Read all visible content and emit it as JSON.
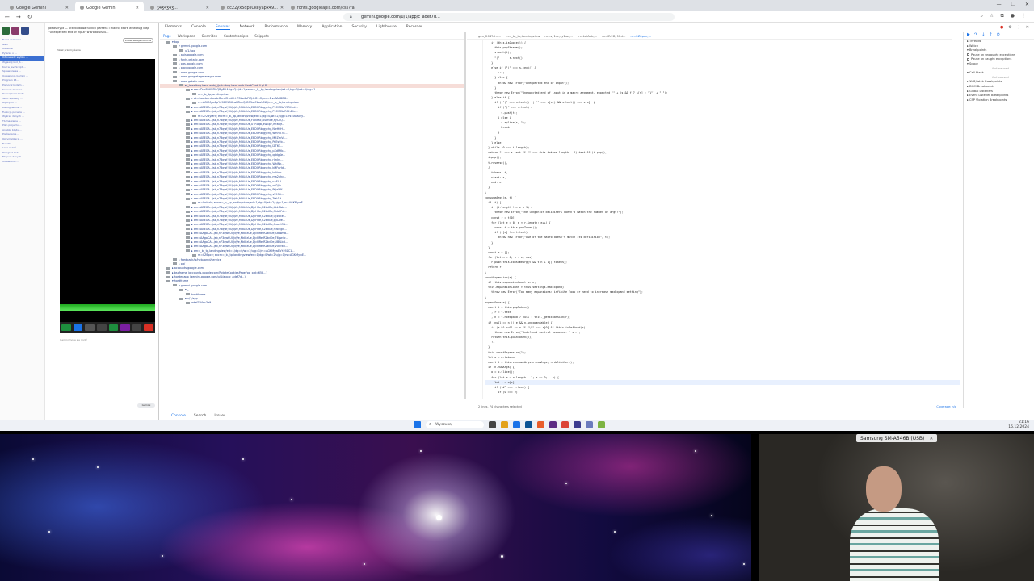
{
  "browser": {
    "tabs": [
      {
        "label": "Google Gemini",
        "active": false
      },
      {
        "label": "Google Gemini",
        "active": true
      },
      {
        "label": "ʒ4ʒ4ʒ4ʒ...",
        "active": false
      },
      {
        "label": "dc22yx5dpsCkeyapx49...",
        "active": false
      },
      {
        "label": "fonts.googleapis.com/css?family...",
        "active": false
      }
    ],
    "url": "gemini.google.com/u/1/app/c_adef7d...",
    "window_controls": [
      "—",
      "❐",
      "✕"
    ]
  },
  "page": {
    "sidebar_items": [
      "Nowa rozmowa",
      "Gem",
      "Ostatnie",
      "Pytanie o ...",
      "Odpowiedz szybko ...",
      "Wyjaśnij kod JS ...",
      "Kod w JavaScript ...",
      "Sprawdzenie ...",
      "Ustawienia Gemini ...",
      "Program 16 ...",
      "Pomoc z kodem ...",
      "Konsola Chrome ...",
      "Rozwiązanie testu ...",
      "Szkic aplikacji ...",
      "Algorytm ...",
      "Debugowanie ...",
      "Funkcja parsera ...",
      "Wykres danych ...",
      "Tłumaczenie ...",
      "Plan projektu ...",
      "Analiza błędu ...",
      "Porównanie ...",
      "Optymalizacja ...",
      "Notatki ...",
      "Lista zadań ...",
      "Przegląd kodu ...",
      "Eksport danych ...",
      "Ustawienia ..."
    ],
    "selected_item_index": 4,
    "title": "Jawaskrypt — przebudowa funkcji parsera i macro, które wywołują błąd \"Unexpected end of input\" w środowisku...",
    "action_button": "Pokaż wersje robocze",
    "subtitle": "Pokaż przemyślenia",
    "footer": "Gemini może się mylić",
    "pill": "Gemini"
  },
  "devtools": {
    "top_tabs": [
      "Elements",
      "Console",
      "Sources",
      "Network",
      "Performance",
      "Memory",
      "Application",
      "Security",
      "Lighthouse",
      "Recorder"
    ],
    "active_top_tab": "Sources",
    "nav_tabs": [
      "Page",
      "Workspace",
      "Overrides",
      "Content scripts",
      "Snippets"
    ],
    "active_nav_tab": "Page",
    "tree": [
      {
        "indent": 0,
        "text": "▾ top"
      },
      {
        "indent": 1,
        "text": "▾ gemini.google.com"
      },
      {
        "indent": 2,
        "text": "u/1/app"
      },
      {
        "indent": 1,
        "text": "▸ apis.google.com"
      },
      {
        "indent": 1,
        "text": "▸ fonts.gstatic.com"
      },
      {
        "indent": 1,
        "text": "▸ ogs.google.com"
      },
      {
        "indent": 1,
        "text": "▸ play.google.com"
      },
      {
        "indent": 1,
        "text": "▸ www.google.com"
      },
      {
        "indent": 1,
        "text": "▸ www.googletagmanager.com"
      },
      {
        "indent": 1,
        "text": "▸ www.gstatic.com"
      },
      {
        "indent": 2,
        "text": "▾ _/mss/boq-bard-web/_/js/k=boq-bard-web.BardChatUi.pl.8..."
      },
      {
        "indent": 3,
        "text": "▾ am=DvcBAKBD8QBgBAAAgAQ=/d=1/excm=_b,_tp,landingview/ed=1/dg=0/wt=2/ujg=1"
      },
      {
        "indent": 4,
        "text": "m=_b,_tp,landingview"
      },
      {
        "indent": 3,
        "text": "▾ ck=boq-bard-web.BardChatUi.hFSbo4bFtQ.L.B1.O/am=DvcBAKBD8..."
      },
      {
        "indent": 4,
        "text": "rs=AGKMywEpYx9ZC1DKtwHRxeQ8MWuM1xoUMA/m=_b,_tp,landingview"
      },
      {
        "indent": 3,
        "text": "▸ am=ABEGA...jsb,n73qwf,UUJqVe,MdUzUe,EEDORb,gychg,P9M9Cb,Y5RHcd..."
      },
      {
        "indent": 3,
        "text": "▸ am=ABEGA...jsb,n73qwf,UUJqVe,MdUzUe,EEDORb,gychg,P9M9Cb,RMhBfe..."
      },
      {
        "indent": 4,
        "text": "m=Zr2ByMrd; excm=_b,_tp,landingview/ed=1/dg=0/wt=2/ujg=1/rs=AGKMy..."
      },
      {
        "indent": 3,
        "text": "▸ am=ABEGA...jsb,n73qwf,UUJqVe,MdUzUe,FGk8ac,DSPnbe,RyCcQ..."
      },
      {
        "indent": 3,
        "text": "▸ am=ABEGA...jsb,n73qwf,UUJqVe,MdUzUe,UTPZqb,aW3pY,Wt6vjf..."
      },
      {
        "indent": 3,
        "text": "▸ am=ABEGA...jsb,n73qwf,UUJqVe,MdUzUe,EEDORb,gychg,NwH0H..."
      },
      {
        "indent": 3,
        "text": "▸ am=ABEGA...jsb,n73qwf,UUJqVe,MdUzUe,EEDORb,gychg,wmnU7d..."
      },
      {
        "indent": 3,
        "text": "▸ am=ABEGA...jsb,n73qwf,UUJqVe,MdUzUe,EEDORb,gychg,M9ZmVc..."
      },
      {
        "indent": 3,
        "text": "▸ am=ABEGA...jsb,n73qwf,UUJqVe,MdUzUe,EEDORb,gychg,PoEs9b..."
      },
      {
        "indent": 3,
        "text": "▸ am=ABEGA...jsb,n73qwf,UUJqVe,MdUzUe,EEDORb,gychg,IZT63..."
      },
      {
        "indent": 3,
        "text": "▸ am=ABEGA...jsb,n73qwf,UUJqVe,MdUzUe,EEDORb,gychg,pXdRYb..."
      },
      {
        "indent": 3,
        "text": "▸ am=ABEGA...jsb,n73qwf,UUJqVe,MdUzUe,EEDORb,gychg,qddgKe..."
      },
      {
        "indent": 3,
        "text": "▸ am=ABEGA...jsb,n73qwf,UUJqVe,MdUzUe,EEDORb,gychg,rJmJrc..."
      },
      {
        "indent": 3,
        "text": "▸ am=ABEGA...jsb,n73qwf,UUJqVe,MdUzUe,EEDORb,gychg,WhJNk..."
      },
      {
        "indent": 3,
        "text": "▸ am=ABEGA...jsb,n73qwf,UUJqVe,MdUzUe,EEDORb,gychg,kMFpHd..."
      },
      {
        "indent": 3,
        "text": "▸ am=ABEGA...jsb,n73qwf,UUJqVe,MdUzUe,EEDORb,gychg,lsjVmc..."
      },
      {
        "indent": 3,
        "text": "▸ am=ABEGA...jsb,n73qwf,UUJqVe,MdUzUe,EEDORb,gychg,ma2uhc..."
      },
      {
        "indent": 3,
        "text": "▸ am=ABEGA...jsb,n73qwf,UUJqVe,MdUzUe,EEDORb,gychg,nAFL3..."
      },
      {
        "indent": 3,
        "text": "▸ am=ABEGA...jsb,n73qwf,UUJqVe,MdUzUe,EEDORb,gychg,o02Jie..."
      },
      {
        "indent": 3,
        "text": "▸ am=ABEGA...jsb,n73qwf,UUJqVe,MdUzUe,EEDORb,gychg,PQaYAf..."
      },
      {
        "indent": 3,
        "text": "▸ am=ABEGA...jsb,n73qwf,UUJqVe,MdUzUe,EEDORb,gychg,s39S4..."
      },
      {
        "indent": 3,
        "text": "▸ am=ABEGA...jsb,n73qwf,UUJqVe,MdUzUe,EEDORb,gychg,TrYr1d..."
      },
      {
        "indent": 4,
        "text": "m=LoiAxb; excm=_b,_tp,landingview/ed=1/dg=0/wt=2/ujg=1/rs=AGKMywE..."
      },
      {
        "indent": 3,
        "text": "▸ am=ABEGA...jsb,n73qwf,UUJqVe,MdUzUe,DjcHRe,R2kdOe,KkLMsb..."
      },
      {
        "indent": 3,
        "text": "▸ am=ABEGA...jsb,n73qwf,UUJqVe,MdUzUe,DjcHRe,R2kdOe,NkbkFd..."
      },
      {
        "indent": 3,
        "text": "▸ am=ABEGA...jsb,n73qwf,UUJqVe,MdUzUe,DjcHRe,R2kdOe,Oj465e..."
      },
      {
        "indent": 3,
        "text": "▸ am=ABEGA...jsb,n73qwf,UUJqVe,MdUzUe,DjcHRe,R2kdOe,pjICDe..."
      },
      {
        "indent": 3,
        "text": "▸ am=ABEGA...jsb,n73qwf,UUJqVe,MdUzUe,DjcHRe,R2kdOe,QwzHOd..."
      },
      {
        "indent": 3,
        "text": "▸ am=ABEGA...jsb,n73qwf,UUJqVe,MdUzUe,DjcHRe,R2kdOe,rE6Mgd..."
      },
      {
        "indent": 3,
        "text": "▸ am=AAgoCA...jsb,n73qwf,UUJqVe,MdUzUe,DjcHRe,R2kdOe,SdcwHb..."
      },
      {
        "indent": 3,
        "text": "▸ am=AAgoCA...jsb,n73qwf,UUJqVe,MdUzUe,DjcHRe,R2kdOe,T6gw4c..."
      },
      {
        "indent": 3,
        "text": "▸ am=AAgoCA...jsb,n73qwf,UUJqVe,MdUzUe,DjcHRe,R2kdOe,UBtLbd..."
      },
      {
        "indent": 3,
        "text": "▸ am=AAgoCA...jsb,n73qwf,UUJqVe,MdUzUe,DjcHRe,R2kdOe,VXdfxd..."
      },
      {
        "indent": 3,
        "text": "▸ am=_b,_tp,landingview/ed=1/dg=0/wt=2/ujg=1/rs=AGKMywEpYx9ZC1..."
      },
      {
        "indent": 4,
        "text": "m=kZ6pce; excm=_b,_tp,landingview/ed=1/dg=0/wt=2/ujg=1/rs=AGKMywE..."
      },
      {
        "indent": 1,
        "text": "▸ feedback/js/help/prod/service"
      },
      {
        "indent": 1,
        "text": "▸ og/_"
      },
      {
        "indent": 0,
        "text": "▸ accounts.google.com"
      },
      {
        "indent": 0,
        "text": "▸ bscframe (accounts.google.com/RotateCookiesPage?og_pid=658...)"
      },
      {
        "indent": 0,
        "text": "▸ hostedapp (gemini.google.com/u/1/app/c_adef7d...)"
      },
      {
        "indent": 0,
        "text": "▾ hostframe"
      },
      {
        "indent": 1,
        "text": "▾ gemini.google.com"
      },
      {
        "indent": 2,
        "text": "▾ _"
      },
      {
        "indent": 3,
        "text": "hostframe"
      },
      {
        "indent": 2,
        "text": "▾ u/1/app"
      },
      {
        "indent": 3,
        "text": "adef7d4ec3a9"
      }
    ],
    "tree_highlight_indices": [
      10
    ],
    "tree_selected_indices": [],
    "editor_tabs": [
      "gen_204?zl=...",
      "m=_b,_tp,landingview",
      "m=sy1sc,sy1se,...",
      "m=LoiAxb,...",
      "m=Zr2ByMrd...",
      "m=kZ6pce,..."
    ],
    "active_editor_tab_index": 5,
    "code_lines": [
      "    if (this.isQuote()) {",
      "      this.popStream();",
      "      s.push(t);",
      "      \"(\"      s.next()",
      "    }",
      "    else if (\"(\" === s.text() {",
      "        ++i;",
      "      } else {",
      "        throw new Error(\"Unexpected end of input\");",
      "      }",
      "      throw new Error(\"Unexpected end of input in a macro argument, expected '\" + (s && f ? s[s] : \"}\") + \"'\");",
      "    } else if {",
      "      if ((\"(\" === s.text() || \"\" === s[s]) && s.text() === s[s]) {",
      "        if (\"(\" === s.text) {",
      "          s.push(t);",
      "        } else {",
      "          s.splice(s, 1);",
      "          break",
      "        }",
      "      }",
      "    } else",
      "  } while (0 === i.length);",
      "  return \"\" === s.text && \"\" === this.tokens.length - 1).text && (i.pop(),",
      "  i.pop(),",
      "  t.reverse(),",
      "  {",
      "    tokens: t,",
      "    start: s,",
      "    end: e",
      "  }",
      "}",
      "consumeArgs(e, t) {",
      "  if (t) {",
      "    if (t.length !== e + 1) {",
      "      throw new Error(\"The length of delimiters doesn't match the number of args!\");",
      "    const r = t[0];",
      "    for (let e = 0; e < r.length; e++) {",
      "      const t = this.popToken();",
      "      if (r[e] !== t.text)",
      "        throw new Error(\"Use of the macro doesn't match its definition\", t);",
      "    }",
      "  }",
      "  const r = [];",
      "  for (let n = 0; n < e; n++)",
      "    r.push(this.consumeArg(t && t[n + 1]).tokens);",
      "  return r",
      "}",
      "countExpansion(e) {",
      "  if (this.expansionCount += e,",
      "  this.expansionCount > this.settings.maxExpand)",
      "    throw new Error(\"Too many expansions: infinite loop or need to increase maxExpand setting\");",
      "}",
      "expandOnce(e) {",
      "  const t = this.popToken()",
      "    , r = t.text",
      "    , n = t.noexpand ? null : this._getExpansion(r);",
      "  if (null == n || e && n.unexpandable) {",
      "    if (e && null == n && \"\\\\\" === r[0] && !this.isDefined(r))",
      "      throw new Error(\"Undefined control sequence: \" + r);",
      "    return this.pushToken(t),",
      "    !1",
      "  }",
      "  this.countExpansion(1);",
      "  let o = n.tokens;",
      "  const l = this.consumeArgs(n.numArgs, n.delimiters);",
      "  if (n.numArgs) {",
      "    o = o.slice();",
      "    for (let e = o.length - 1; e >= 0; --e) {",
      "      let t = o[e];",
      "      if (\"#\" === t.text) {",
      "        if (0 === e)"
    ],
    "current_line_index": 68,
    "status_text": "2 lines, 74 characters selected",
    "status_right": "Coverage: n/a",
    "debugger_items": [
      "▸ Threads",
      "▸ Watch",
      "▾ Breakpoints",
      "Pause on uncaught exceptions",
      "Pause on caught exceptions",
      "▾ Scope",
      "Not paused",
      "▾ Call Stack",
      "Not paused",
      "▸ XHR/fetch Breakpoints",
      "▸ DOM Breakpoints",
      "▸ Global Listeners",
      "▸ Event Listener Breakpoints",
      "▸ CSP Violation Breakpoints"
    ],
    "bottom_tabs": [
      "Console",
      "Search",
      "Issues"
    ],
    "active_bottom_tab": "Console"
  },
  "taskbar": {
    "search_placeholder": "Wyszukaj",
    "time": "21:16",
    "date": "16.12.2024"
  },
  "stream": {
    "cam_label": "Samsung SM-A546B (USB)"
  },
  "colors": {
    "accent": "#1a73e8",
    "highlight_row": "#f6ddd8",
    "tree_text": "#1f3d8a"
  }
}
